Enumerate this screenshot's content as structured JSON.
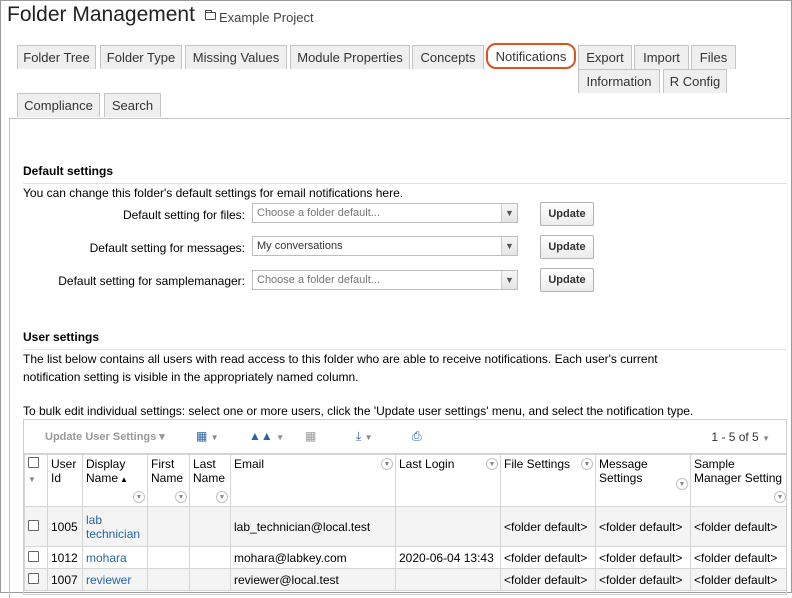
{
  "header": {
    "title": "Folder Management",
    "project": "Example Project",
    "project_icon": "folder-icon"
  },
  "tabs": [
    {
      "label": "Folder Tree"
    },
    {
      "label": "Folder Type"
    },
    {
      "label": "Missing Values"
    },
    {
      "label": "Module Properties"
    },
    {
      "label": "Concepts"
    },
    {
      "label": "Notifications",
      "active": true
    },
    {
      "label": "Export"
    },
    {
      "label": "Import"
    },
    {
      "label": "Files"
    },
    {
      "label": "Information"
    },
    {
      "label": "R Config"
    },
    {
      "label": "Compliance"
    },
    {
      "label": "Search"
    }
  ],
  "default_settings": {
    "title": "Default settings",
    "description": "You can change this folder's default settings for email notifications here.",
    "rows": [
      {
        "label": "Default setting for files:",
        "value": "Choose a folder default...",
        "placeholder": true,
        "button": "Update"
      },
      {
        "label": "Default setting for messages:",
        "value": "My conversations",
        "placeholder": false,
        "button": "Update"
      },
      {
        "label": "Default setting for samplemanager:",
        "value": "Choose a folder default...",
        "placeholder": true,
        "button": "Update"
      }
    ]
  },
  "user_settings": {
    "title": "User settings",
    "desc_line1": "The list below contains all users with read access to this folder who are able to receive notifications. Each user's current",
    "desc_line2": "notification setting is visible in the appropriately named column.",
    "bulk_text": "To bulk edit individual settings: select one or more users, click the 'Update user settings' menu, and select the notification type."
  },
  "grid": {
    "toolbar": {
      "update_label": "Update User Settings",
      "grid_icon": "grid-view-icon",
      "chart_icon": "chart-icon",
      "delete_icon": "trash-icon",
      "export_icon": "download-icon",
      "print_icon": "print-icon",
      "pager": "1 - 5 of 5"
    },
    "columns": {
      "user_id": "User Id",
      "display_name": "Display Name",
      "first_name": "First Name",
      "last_name": "Last Name",
      "email": "Email",
      "last_login": "Last Login",
      "file_settings": "File Settings",
      "message_settings": "Message Settings",
      "sample_manager": "Sample Manager Setting"
    },
    "rows": [
      {
        "user_id": "1005",
        "display_name": "lab technician",
        "first_name": "",
        "last_name": "",
        "email": "lab_technician@local.test",
        "last_login": "",
        "file": "<folder default>",
        "message": "<folder default>",
        "sample": "<folder default>"
      },
      {
        "user_id": "1012",
        "display_name": "mohara",
        "first_name": "",
        "last_name": "",
        "email": "mohara@labkey.com",
        "last_login": "2020-06-04 13:43",
        "file": "<folder default>",
        "message": "<folder default>",
        "sample": "<folder default>"
      },
      {
        "user_id": "1007",
        "display_name": "reviewer",
        "first_name": "",
        "last_name": "",
        "email": "reviewer@local.test",
        "last_login": "",
        "file": "<folder default>",
        "message": "<folder default>",
        "sample": "<folder default>"
      }
    ]
  },
  "colors": {
    "active_tab_outline": "#d9541f",
    "link": "#2565a8"
  }
}
